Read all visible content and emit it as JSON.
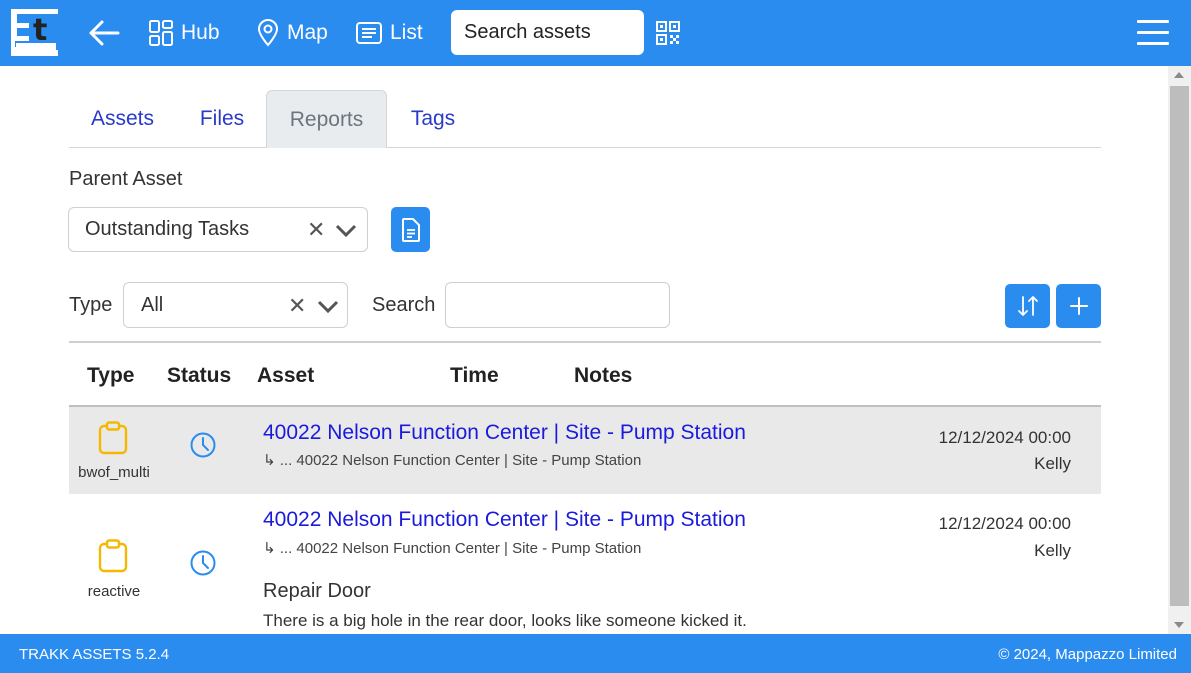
{
  "topbar": {
    "logo_letter": "t",
    "nav": {
      "hub_label": "Hub",
      "map_label": "Map",
      "list_label": "List"
    },
    "search_placeholder": "Search assets",
    "icons": {
      "back": "arrow-left-icon",
      "hub": "grid-icon",
      "map": "map-pin-icon",
      "list": "list-icon",
      "qr": "qr-code-icon",
      "menu": "hamburger-menu-icon"
    }
  },
  "tabs": [
    {
      "label": "Assets",
      "active": false
    },
    {
      "label": "Files",
      "active": false
    },
    {
      "label": "Reports",
      "active": true
    },
    {
      "label": "Tags",
      "active": false
    }
  ],
  "filters": {
    "parent_asset_label": "Parent Asset",
    "parent_asset_value": "Outstanding Tasks",
    "type_label": "Type",
    "type_value": "All",
    "search_label": "Search",
    "search_value": ""
  },
  "table": {
    "headers": {
      "type": "Type",
      "status": "Status",
      "asset": "Asset",
      "time": "Time",
      "notes": "Notes"
    },
    "rows": [
      {
        "type": "bwof_multi",
        "status_icon": "clock-icon",
        "asset": "40022 Nelson Function Center | Site - Pump Station",
        "parent": "↳ ... 40022 Nelson Function Center | Site - Pump Station",
        "time": "12/12/2024 00:00",
        "person": "Kelly",
        "note_title": "",
        "note_body": ""
      },
      {
        "type": "reactive",
        "status_icon": "clock-icon",
        "asset": "40022 Nelson Function Center | Site - Pump Station",
        "parent": "↳ ... 40022 Nelson Function Center | Site - Pump Station",
        "time": "12/12/2024 00:00",
        "person": "Kelly",
        "note_title": "Repair Door",
        "note_body": "There is a big hole in the rear door, looks like someone kicked it."
      }
    ]
  },
  "footer": {
    "version": "TRAKK ASSETS 5.2.4",
    "copyright": "© 2024,  Mappazzo Limited"
  },
  "colors": {
    "brand_blue": "#2b8cf0",
    "link_blue": "#1a1adc",
    "tab_blue": "#2a3ac8",
    "type_icon_yellow": "#f5b800"
  }
}
